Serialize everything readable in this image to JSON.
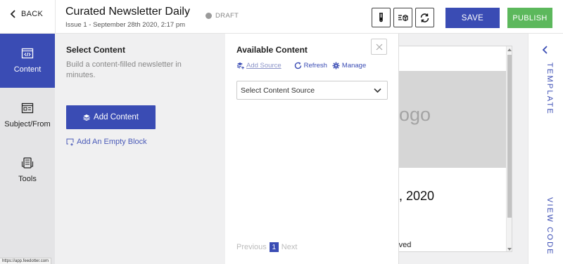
{
  "header": {
    "back_label": "BACK",
    "title": "Curated Newsletter Daily",
    "subtitle": "Issue 1 - September 28th 2020, 2:17 pm",
    "status": "DRAFT",
    "save_label": "SAVE",
    "publish_label": "PUBLISH"
  },
  "sidebar": {
    "items": [
      {
        "label": "Content",
        "icon": "code-window-icon",
        "active": true
      },
      {
        "label": "Subject/From",
        "icon": "newsletter-form-icon",
        "active": false
      },
      {
        "label": "Tools",
        "icon": "tools-icon",
        "active": false
      }
    ],
    "status_url": "https://app.feedotter.com"
  },
  "select_content": {
    "title": "Select Content",
    "description": "Build a content-filled newsletter in minutes.",
    "add_content_label": "Add Content",
    "add_empty_block_label": "Add An Empty Block"
  },
  "available_content": {
    "title": "Available Content",
    "add_source_label": "Add Source",
    "refresh_label": "Refresh",
    "manage_label": "Manage",
    "source_select": "Select Content Source",
    "pager": {
      "previous": "Previous",
      "current": "1",
      "next": "Next"
    }
  },
  "preview": {
    "logo_text_visible": "ogo",
    "date_visible": ", 2020",
    "footer_visible": "rved"
  },
  "right_rail": {
    "template_label": "TEMPLATE",
    "view_code_label": "VIEW CODE"
  },
  "colors": {
    "primary": "#3a4cb4",
    "publish": "#5cb85c",
    "nav_bg": "#e4e4e6"
  }
}
